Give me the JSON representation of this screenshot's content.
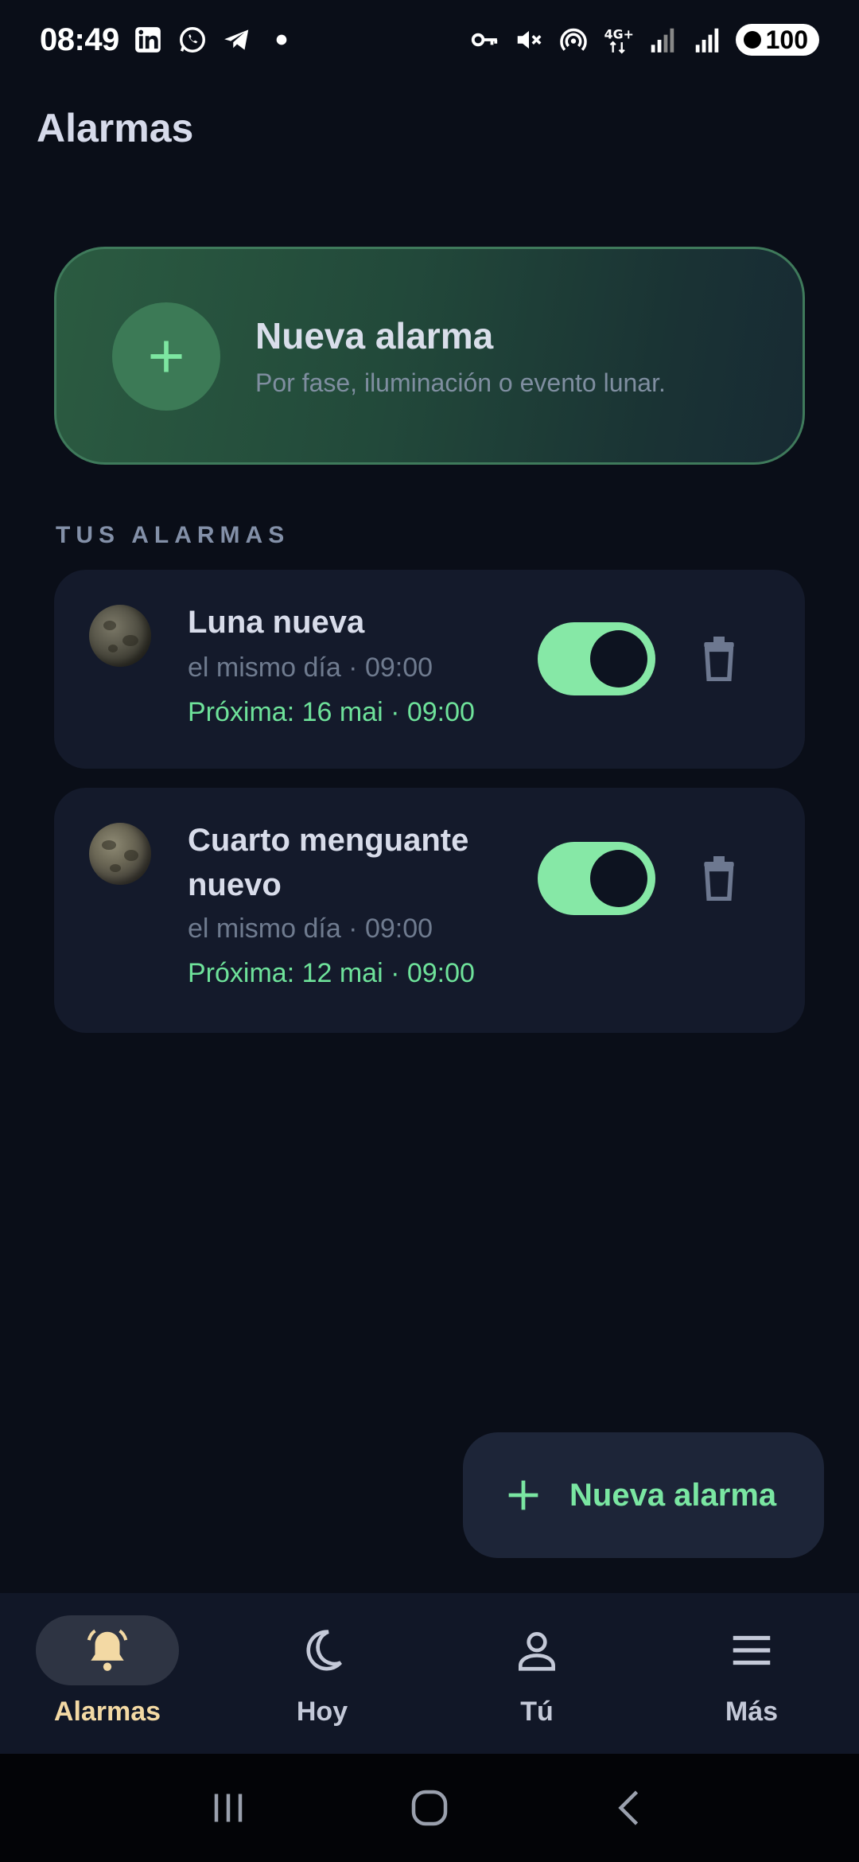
{
  "status_bar": {
    "time": "08:49",
    "left_icons": [
      "linkedin-icon",
      "whatsapp-icon",
      "telegram-icon",
      "dot-icon"
    ],
    "right_icons": [
      "vpn-key-icon",
      "mute-icon",
      "hotspot-icon",
      "4g-icon",
      "signal-icon",
      "signal-icon"
    ],
    "network_label": "4G+",
    "battery": "100"
  },
  "header": {
    "title": "Alarmas"
  },
  "hero": {
    "title": "Nueva alarma",
    "subtitle": "Por fase, iluminación o evento lunar."
  },
  "section": {
    "label": "TUS ALARMAS"
  },
  "alarms": [
    {
      "title": "Luna nueva",
      "schedule": "el mismo día · 09:00",
      "next": "Próxima: 16 mai · 09:00",
      "enabled": true
    },
    {
      "title": "Cuarto menguante nuevo",
      "schedule": "el mismo día · 09:00",
      "next": "Próxima: 12 mai · 09:00",
      "enabled": true
    }
  ],
  "fab": {
    "label": "Nueva alarma"
  },
  "bottom_nav": {
    "items": [
      {
        "label": "Alarmas",
        "icon": "bell-icon",
        "active": true
      },
      {
        "label": "Hoy",
        "icon": "moon-icon",
        "active": false
      },
      {
        "label": "Tú",
        "icon": "person-icon",
        "active": false
      },
      {
        "label": "Más",
        "icon": "menu-icon",
        "active": false
      }
    ]
  },
  "colors": {
    "background": "#0a0e18",
    "accent_green": "#86e8a6",
    "active_nav": "#f3d9a4",
    "card": "#141a2b"
  }
}
